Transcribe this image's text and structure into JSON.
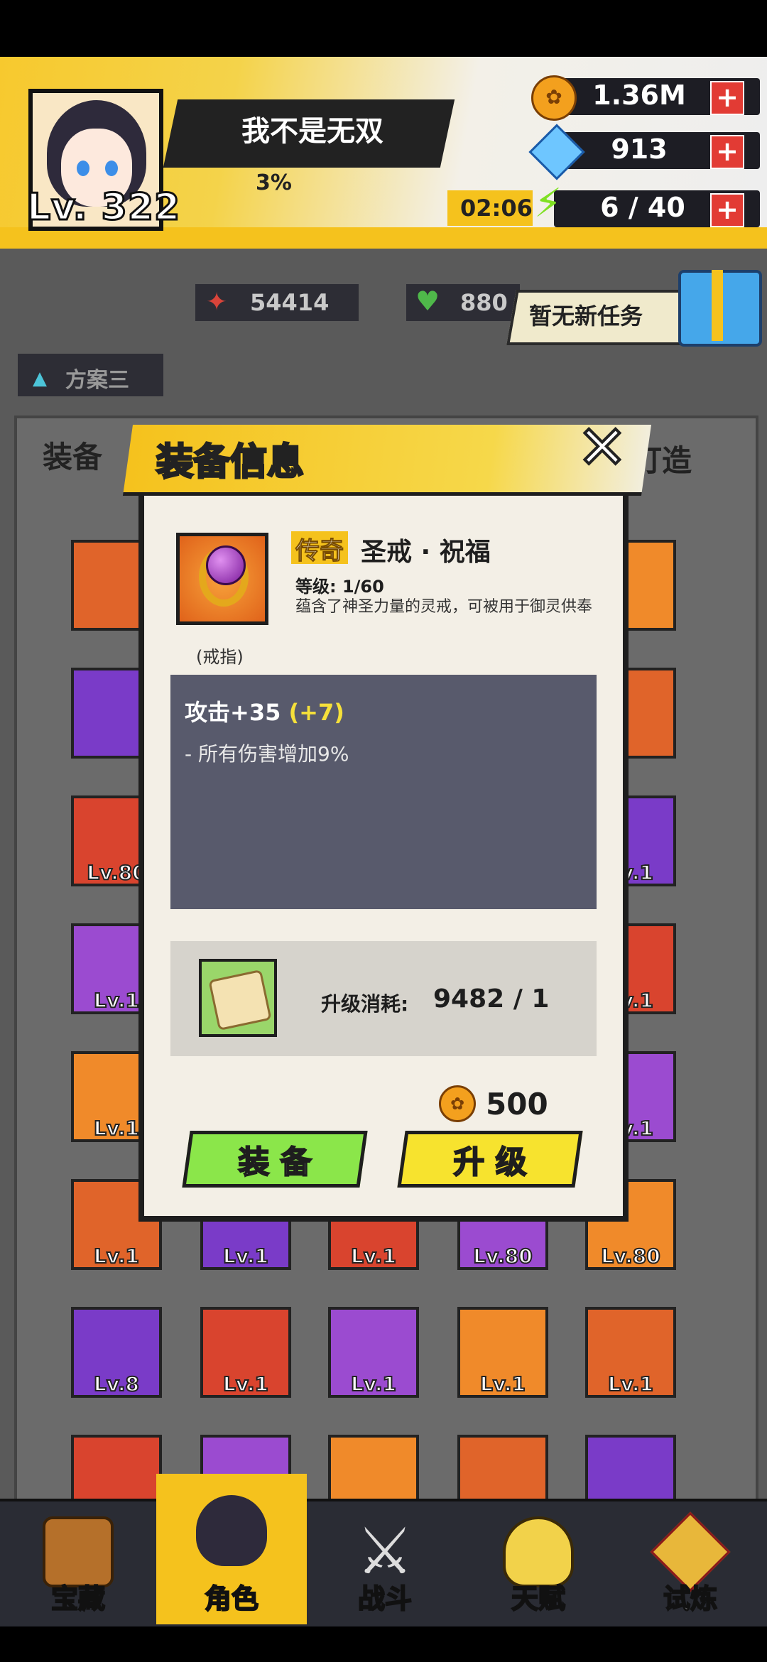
{
  "player": {
    "name": "我不是无双",
    "level": "Lv. 322",
    "exp_pct": "3%"
  },
  "resources": {
    "gold": "1.36M",
    "gems": "913",
    "energy_timer": "02:06",
    "energy": "6 / 40",
    "plus": "+"
  },
  "stats": {
    "attack": "54414",
    "hp": "880"
  },
  "task_banner": "暂无新任务",
  "plan_tab": "方案三",
  "background_tabs": {
    "left": "装备",
    "right": "打造"
  },
  "background_levels": [
    "Lv.80",
    "Lv.80",
    "Lv.8",
    "Lv.1",
    "Lv.1",
    "Lv.1",
    "Lv.1",
    "Lv.1",
    "Lv.1",
    "Lv.1",
    "Lv.1",
    "Lv.1",
    "Lv.1",
    "Lv.1",
    "Lv.1",
    "Lv.1",
    "Lv.1",
    "Lv.1"
  ],
  "modal": {
    "title": "装备信息",
    "close": "✕",
    "item": {
      "rarity": "传奇",
      "name": "圣戒 · 祝福",
      "level": "等级: 1/60",
      "description": "蕴含了神圣力量的灵戒，可被用于御灵供奉",
      "type": "(戒指)"
    },
    "stat_main": "攻击+35",
    "stat_bonus": "(+7)",
    "stat_sub": "- 所有伤害增加9%",
    "cost_label": "升级消耗:",
    "cost_value": "9482 / 1",
    "gold_cost": "500",
    "equip_button": "装 备",
    "upgrade_button": "升 级"
  },
  "nav": [
    {
      "label": "宝藏",
      "icon": "treasure-chest-icon"
    },
    {
      "label": "角色",
      "icon": "character-icon"
    },
    {
      "label": "战斗",
      "icon": "sword-icon"
    },
    {
      "label": "天赋",
      "icon": "lightbulb-icon"
    },
    {
      "label": "试炼",
      "icon": "trial-emblem-icon"
    }
  ],
  "colors": {
    "accent": "#f5c21d",
    "equip_green": "#8be64a",
    "upgrade_yellow": "#f7e32e",
    "stat_box": "#585a6c"
  }
}
